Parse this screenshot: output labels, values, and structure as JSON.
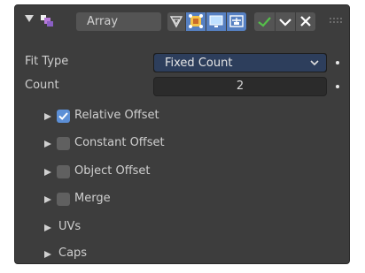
{
  "modifier": {
    "name": "Array",
    "toolbar_icons": [
      "vertex-mode-icon",
      "edit-mode-icon",
      "realtime-display-icon",
      "cage-icon",
      "apply-icon",
      "dropdown-chevron-icon",
      "close-icon",
      "drag-handle-icon"
    ]
  },
  "fit_type": {
    "label": "Fit Type",
    "value": "Fixed Count"
  },
  "count": {
    "label": "Count",
    "value": "2"
  },
  "subpanels": [
    {
      "label": "Relative Offset",
      "has_checkbox": true,
      "checked": true
    },
    {
      "label": "Constant Offset",
      "has_checkbox": true,
      "checked": false
    },
    {
      "label": "Object Offset",
      "has_checkbox": true,
      "checked": false
    },
    {
      "label": "Merge",
      "has_checkbox": true,
      "checked": false
    },
    {
      "label": "UVs",
      "has_checkbox": false,
      "checked": false
    },
    {
      "label": "Caps",
      "has_checkbox": false,
      "checked": false
    }
  ],
  "colors": {
    "panel_bg": "#3d3d3d",
    "accent_blue": "#5680c2",
    "checkbox_on": "#5c8fd6",
    "apply_green": "#55c04a"
  }
}
